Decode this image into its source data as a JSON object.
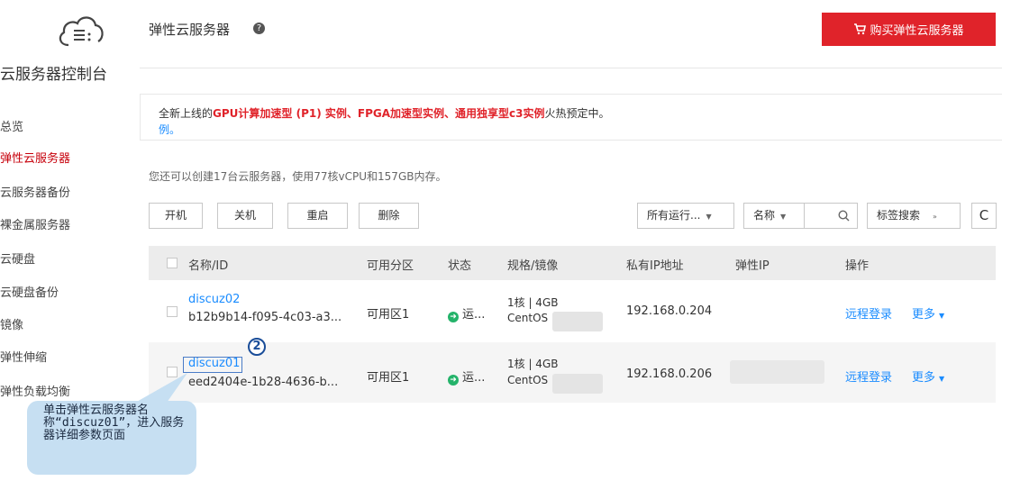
{
  "sidebar": {
    "title": "云服务器控制台",
    "items": [
      {
        "label": "总览",
        "active": false
      },
      {
        "label": "弹性云服务器",
        "active": true
      },
      {
        "label": "云服务器备份",
        "active": false
      },
      {
        "label": "裸金属服务器",
        "active": false
      },
      {
        "label": "云硬盘",
        "active": false
      },
      {
        "label": "云硬盘备份",
        "active": false
      },
      {
        "label": "镜像",
        "active": false
      },
      {
        "label": "弹性伸缩",
        "active": false
      },
      {
        "label": "弹性负载均衡",
        "active": false
      }
    ]
  },
  "header": {
    "title": "弹性云服务器",
    "help_icon": "?",
    "buy_button": "购买弹性云服务器"
  },
  "notice": {
    "prefix": "全新上线的",
    "highlight": "GPU计算加速型 (P1) 实例、FPGA加速型实例、通用独享型c3实例",
    "suffix": "火热预定中。",
    "link": "例。"
  },
  "quota_text": "您还可以创建17台云服务器，使用77核vCPU和157GB内存。",
  "toolbar": {
    "start": "开机",
    "stop": "关机",
    "restart": "重启",
    "delete": "删除",
    "status_filter": "所有运行...",
    "name_filter": "名称",
    "tag_search": "标签搜索",
    "refresh_icon": "C"
  },
  "table": {
    "columns": [
      "名称/ID",
      "可用分区",
      "状态",
      "规格/镜像",
      "私有IP地址",
      "弹性IP",
      "操作"
    ],
    "rows": [
      {
        "name": "discuz02",
        "id": "b12b9b14-f095-4c03-a3...",
        "zone": "可用区1",
        "status": "运...",
        "spec": "1核 | 4GB",
        "image": "CentOS",
        "ip": "192.168.0.204",
        "remote": "远程登录",
        "more": "更多"
      },
      {
        "name": "discuz01",
        "id": "eed2404e-1b28-4636-b...",
        "zone": "可用区1",
        "status": "运...",
        "spec": "1核 | 4GB",
        "image": "CentOS",
        "ip": "192.168.0.206",
        "remote": "远程登录",
        "more": "更多"
      }
    ]
  },
  "annotation": {
    "step": "2",
    "text": "单击弹性云服务器名称“discuz01”，进入服务器详细参数页面"
  },
  "colors": {
    "accent": "#e0232a",
    "link": "#1a8cff",
    "active": "#c7000b",
    "callout": "#c6dff2"
  }
}
